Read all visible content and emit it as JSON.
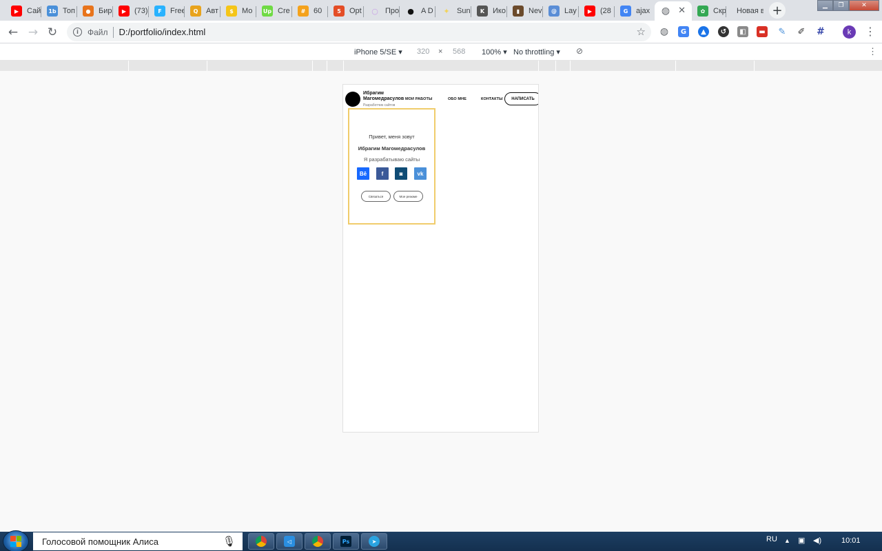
{
  "browser": {
    "tabs": [
      {
        "title": "Сай",
        "icon": "youtube-icon",
        "color": "#ff0000",
        "glyph": "▶"
      },
      {
        "title": "Топ",
        "icon": "1b-icon",
        "color": "#4a90d9",
        "glyph": "1b"
      },
      {
        "title": "Бир",
        "icon": "fox-icon",
        "color": "#e8741c",
        "glyph": "●"
      },
      {
        "title": "(73)",
        "icon": "youtube-icon",
        "color": "#ff0000",
        "glyph": "▶"
      },
      {
        "title": "Free",
        "icon": "freelancer-icon",
        "color": "#29b2fe",
        "glyph": "F"
      },
      {
        "title": "Авт",
        "icon": "search-icon",
        "color": "#e8a31c",
        "glyph": "Q"
      },
      {
        "title": "Мо",
        "icon": "coin-icon",
        "color": "#f5c518",
        "glyph": "$"
      },
      {
        "title": "Cre",
        "icon": "upwork-icon",
        "color": "#6fda44",
        "glyph": "Up"
      },
      {
        "title": "60 ",
        "icon": "grid-icon",
        "color": "#f4a21c",
        "glyph": "#"
      },
      {
        "title": "Opt",
        "icon": "html5-icon",
        "color": "#e44d26",
        "glyph": "5"
      },
      {
        "title": "Про",
        "icon": "loading-icon",
        "color": "#c9a3e6",
        "glyph": "○"
      },
      {
        "title": "A D",
        "icon": "dot-icon",
        "color": "#111111",
        "glyph": "●"
      },
      {
        "title": "Sun",
        "icon": "sun-icon",
        "color": "#f2d35b",
        "glyph": "✦"
      },
      {
        "title": "Ико",
        "icon": "brush-icon",
        "color": "#555555",
        "glyph": "K"
      },
      {
        "title": "Nev",
        "icon": "picture-icon",
        "color": "#6b4a2b",
        "glyph": "▮"
      },
      {
        "title": "Lay",
        "icon": "layout-icon",
        "color": "#5a8dd6",
        "glyph": "@"
      },
      {
        "title": "(28",
        "icon": "youtube-icon",
        "color": "#ff0000",
        "glyph": "▶"
      },
      {
        "title": "ajax",
        "icon": "google-icon",
        "color": "#4285f4",
        "glyph": "G"
      },
      {
        "title": "",
        "icon": "globe-icon",
        "color": "#5f6368",
        "glyph": "◍"
      },
      {
        "title": "Скр",
        "icon": "pinwheel-icon",
        "color": "#34a853",
        "glyph": "✿"
      },
      {
        "title": "Новая в",
        "icon": "",
        "color": "#ffffff",
        "glyph": ""
      }
    ],
    "address": {
      "scheme_label": "Файл",
      "url": "D:/portfolio/index.html"
    },
    "profile_initial": "k"
  },
  "devtools": {
    "device": "iPhone 5/SE",
    "width": "320",
    "times": "×",
    "height": "568",
    "zoom": "100%",
    "throttling": "No throttling"
  },
  "site": {
    "name": "Ибрагим Магомедрасулов",
    "subtitle": "Разработчик сайтов",
    "nav": [
      "МОИ РАБОТЫ",
      "ОБО МНЕ",
      "КОНТАКТЫ"
    ],
    "write_button": "НАПИСАТЬ",
    "hero": {
      "greeting": "Привет, меня зовут",
      "name": "Ибрагим Магомедрасулов",
      "role": "Я разрабатываю сайты",
      "socials": [
        {
          "label": "Bē",
          "icon": "behance-icon",
          "color": "#1769ff"
        },
        {
          "label": "f",
          "icon": "facebook-icon",
          "color": "#3b5998"
        },
        {
          "label": "◙",
          "icon": "instagram-icon",
          "color": "#0f4c75"
        },
        {
          "label": "vk",
          "icon": "vk-icon",
          "color": "#4a90d9"
        }
      ],
      "buttons": [
        "Связаться",
        "Мое резюме"
      ]
    }
  },
  "taskbar": {
    "search_text": "Голосовой помощник Алиса",
    "language": "RU",
    "time": "10:01",
    "apps": [
      {
        "icon": "chrome-icon",
        "color": "#e8a31c"
      },
      {
        "icon": "vscode-icon",
        "color": "#2a8ee0"
      },
      {
        "icon": "chrome-icon",
        "color": "#e8a31c"
      },
      {
        "icon": "photoshop-icon",
        "color": "#001e36"
      },
      {
        "icon": "telegram-icon",
        "color": "#2aa3e0"
      }
    ]
  }
}
